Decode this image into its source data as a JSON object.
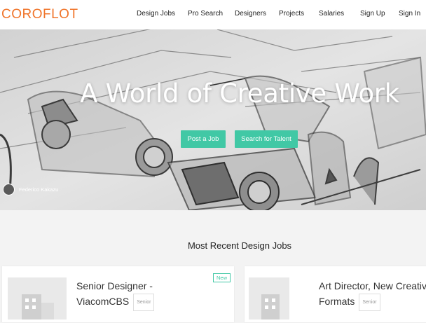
{
  "header": {
    "logo": "COROFLOT",
    "nav": [
      "Design Jobs",
      "Pro Search",
      "Designers",
      "Projects",
      "Salaries",
      "Sign Up",
      "Sign In"
    ]
  },
  "hero": {
    "title": "A World of Creative Work",
    "buttons": [
      "Post a Job",
      "Search for Talent"
    ],
    "credit": "Federico Kakazu"
  },
  "section": {
    "title": "Most Recent Design Jobs"
  },
  "jobs": [
    {
      "title_line1": "Senior Designer -",
      "title_line2": "ViacomCBS",
      "level": "Senior",
      "flag": "New"
    },
    {
      "title_line1": "Art Director, New Creative",
      "title_line2": "Formats",
      "level": "Senior"
    }
  ],
  "colors": {
    "brand": "#f0752b",
    "accent": "#41c8a5"
  }
}
